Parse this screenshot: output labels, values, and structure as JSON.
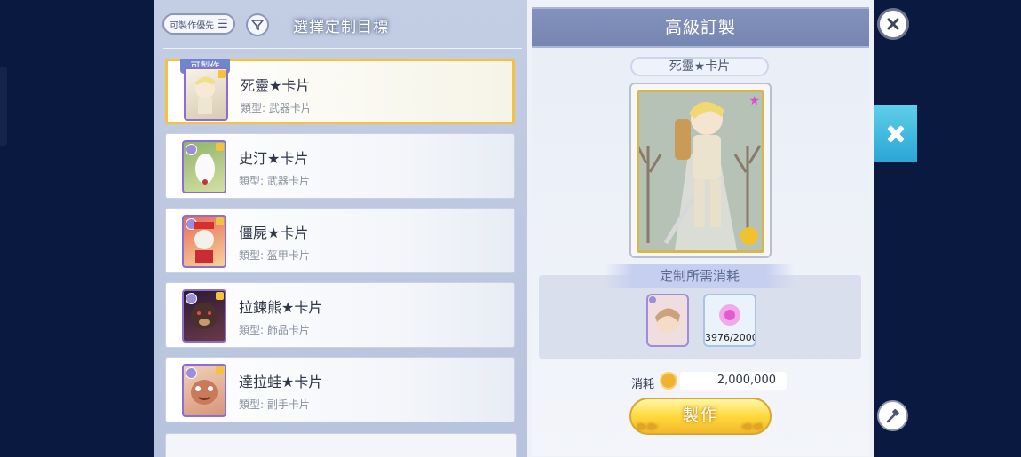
{
  "left_panel": {
    "sort_label": "可製作優先",
    "title": "選擇定制目標",
    "craftable_tag": "可製作",
    "type_prefix": "類型:",
    "cards": [
      {
        "name": "死靈★卡片",
        "type": "武器卡片",
        "selected": true
      },
      {
        "name": "史汀★卡片",
        "type": "武器卡片"
      },
      {
        "name": "僵屍★卡片",
        "type": "盔甲卡片"
      },
      {
        "name": "拉鍊熊★卡片",
        "type": "飾品卡片"
      },
      {
        "name": "達拉蛙★卡片",
        "type": "副手卡片"
      }
    ]
  },
  "right_panel": {
    "title": "高級訂製",
    "preview_name": "死靈★卡片",
    "cost_title": "定制所需消耗",
    "material_count": "3976/2000",
    "consume_label": "消耗",
    "consume_value": "2,000,000",
    "make_button": "製作"
  },
  "colors": {
    "accent_gold": "#f5c23b",
    "header_blue": "#7686b2",
    "side_tab": "#29a6d6"
  }
}
